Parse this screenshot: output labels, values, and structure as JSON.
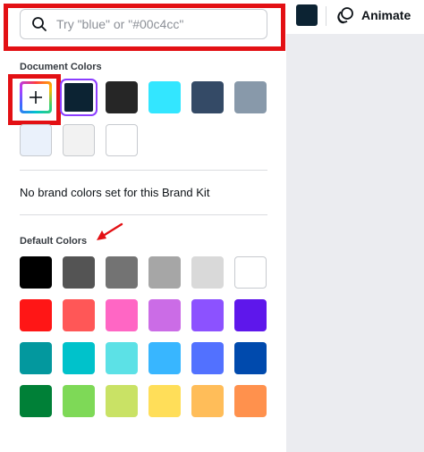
{
  "search": {
    "placeholder": "Try \"blue\" or \"#00c4cc\""
  },
  "topbar": {
    "current_color": "#0c2333",
    "animate_label": "Animate"
  },
  "document_colors": {
    "label": "Document Colors",
    "add_icon": "plus-icon",
    "colors": [
      "#0c2333",
      "#262626",
      "#33e6ff",
      "#344a66",
      "#8899aa",
      "#eaf1fb",
      "#f2f2f2",
      "#ffffff"
    ]
  },
  "brand": {
    "message": "No brand colors set for this Brand Kit"
  },
  "default_colors": {
    "label": "Default Colors",
    "colors": [
      "#000000",
      "#545454",
      "#737373",
      "#a6a6a6",
      "#d9d9d9",
      "#ffffff",
      "#ff1616",
      "#ff5757",
      "#ff66c4",
      "#cb6ce6",
      "#8c52ff",
      "#5e17eb",
      "#03989e",
      "#00c2cb",
      "#5ce1e6",
      "#38b6ff",
      "#5271ff",
      "#004aad",
      "#008037",
      "#7ed957",
      "#c9e265",
      "#ffde59",
      "#ffbd59",
      "#ff914d"
    ]
  },
  "annotation_color": "#e31014",
  "selection_color": "#8b3dff"
}
